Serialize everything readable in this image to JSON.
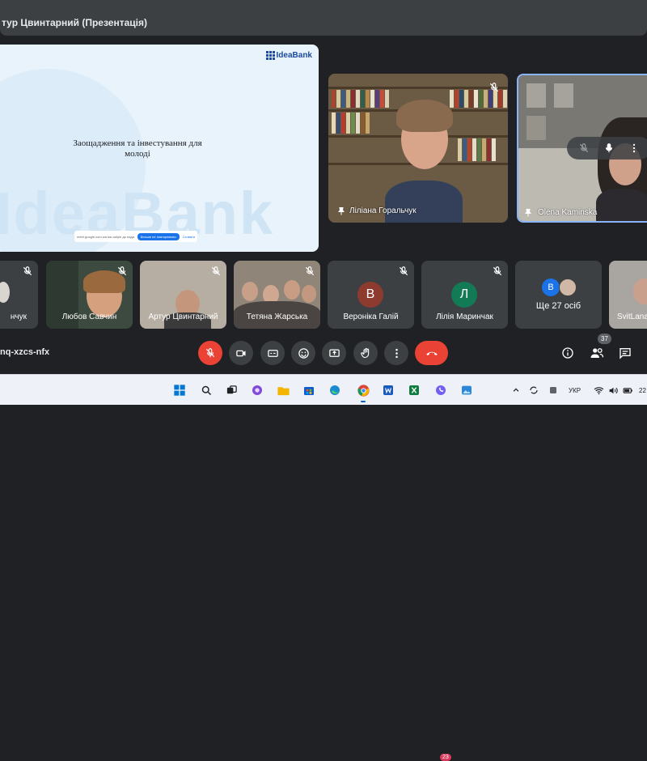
{
  "window": {
    "title": "тур Цвинтарний (Презентація)"
  },
  "presentation": {
    "logo": "IdeaBank",
    "heading": "Заощадження та інвестування для молоді",
    "watermark": "IdeaBank",
    "consent_text": "meet.google.com wа мы ustyle до надати вкрай",
    "consent_ok": "Більше не повторювати",
    "consent_more": "Сховати"
  },
  "main_tiles": [
    {
      "name": "Ліліана Горальчук"
    },
    {
      "name": "Olena Kaminska"
    }
  ],
  "strip_tiles": [
    {
      "name": "нчук"
    },
    {
      "name": "Любов Савчин"
    },
    {
      "name": "Артур Цвинтарний"
    },
    {
      "name": "Тетяна Жарська"
    },
    {
      "name": "Вероніка Галій",
      "initial": "В",
      "color": "#8e3b2f"
    },
    {
      "name": "Лілія Маринчак",
      "initial": "Л",
      "color": "#127a55"
    },
    {
      "name": "Ще 27 осіб",
      "initial": "В",
      "color": "#1a73e8"
    },
    {
      "name": "SvitLana"
    }
  ],
  "meeting": {
    "code": "nq-xzcs-nfx",
    "participants_count": "37"
  },
  "taskbar": {
    "language": "УКР",
    "time": "22",
    "badge": "23"
  },
  "colors": {
    "accent": "#8ab4f8",
    "hangup": "#ea4335",
    "control": "#3c4043"
  }
}
